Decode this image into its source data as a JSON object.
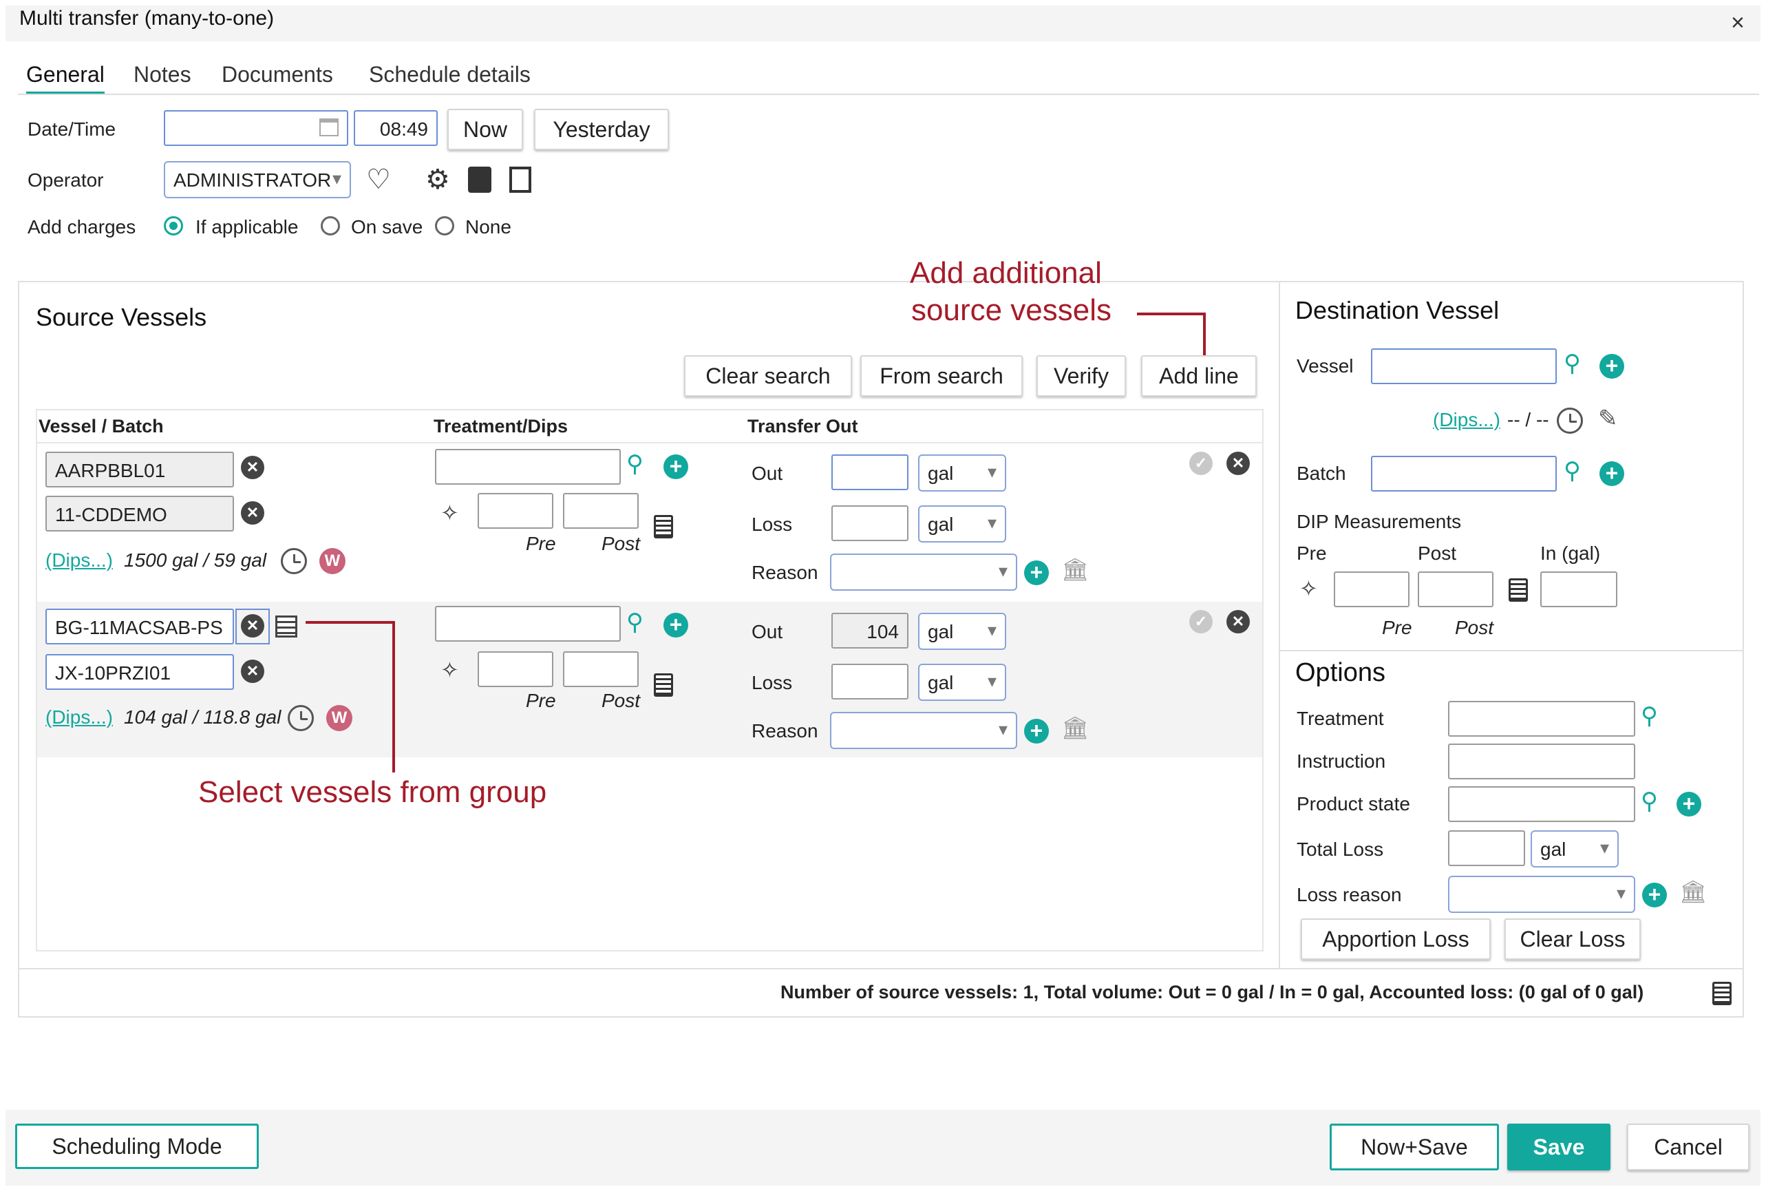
{
  "window": {
    "title": "Multi transfer (many-to-one)",
    "close_glyph": "×"
  },
  "tabs": [
    "General",
    "Notes",
    "Documents",
    "Schedule details"
  ],
  "general": {
    "datetime_label": "Date/Time",
    "time_value": "08:49",
    "now_label": "Now",
    "yesterday_label": "Yesterday",
    "operator_label": "Operator",
    "operator_value": "ADMINISTRATOR",
    "add_charges_label": "Add charges",
    "charge_options": [
      "If applicable",
      "On save",
      "None"
    ],
    "charge_selected": "If applicable"
  },
  "source": {
    "title": "Source Vessels",
    "buttons": {
      "clear_search": "Clear search",
      "from_search": "From search",
      "verify": "Verify",
      "add_line": "Add line"
    },
    "columns": [
      "Vessel / Batch",
      "Treatment/Dips",
      "Transfer Out"
    ],
    "pre_label": "Pre",
    "post_label": "Post",
    "out_label": "Out",
    "loss_label": "Loss",
    "reason_label": "Reason",
    "unit": "gal",
    "dips_link": "(Dips...)",
    "rows": [
      {
        "vessel": "AARPBBL01",
        "batch": "11-CDDEMO",
        "dips_summary": "1500 gal / 59 gal",
        "out_value": ""
      },
      {
        "vessel": "BG-11MACSAB-PS",
        "batch": "JX-10PRZI01",
        "dips_summary": "104 gal / 118.8 gal",
        "out_value": "104"
      }
    ]
  },
  "annotations": {
    "add_line_line1": "Add additional",
    "add_line_line2": "source vessels",
    "group": "Select vessels from group"
  },
  "destination": {
    "title": "Destination Vessel",
    "vessel_label": "Vessel",
    "dips_link": "(Dips...)",
    "dips_value": "-- / --",
    "batch_label": "Batch",
    "dip_title": "DIP Measurements",
    "pre_label": "Pre",
    "post_label": "Post",
    "in_label": "In (gal)"
  },
  "options": {
    "title": "Options",
    "treatment_label": "Treatment",
    "instruction_label": "Instruction",
    "product_state_label": "Product state",
    "total_loss_label": "Total Loss",
    "unit": "gal",
    "loss_reason_label": "Loss reason",
    "apportion_loss": "Apportion Loss",
    "clear_loss": "Clear Loss"
  },
  "summary": "Number of source vessels: 1, Total volume: Out = 0 gal / In = 0 gal, Accounted loss: (0 gal of 0 gal)",
  "footer": {
    "scheduling_mode": "Scheduling Mode",
    "now_save": "Now+Save",
    "save": "Save",
    "cancel": "Cancel"
  },
  "colors": {
    "accent": "#12a89d",
    "annotation": "#a51c2a",
    "w_badge": "#c9627a"
  },
  "icons": [
    "calendar-icon",
    "heart-icon",
    "gear-icon",
    "contact-card-icon",
    "document-icon",
    "search-icon",
    "add-icon",
    "remove-icon",
    "check-icon",
    "clock-icon",
    "wand-icon",
    "calculator-icon",
    "bank-icon",
    "list-icon",
    "pen-icon"
  ]
}
